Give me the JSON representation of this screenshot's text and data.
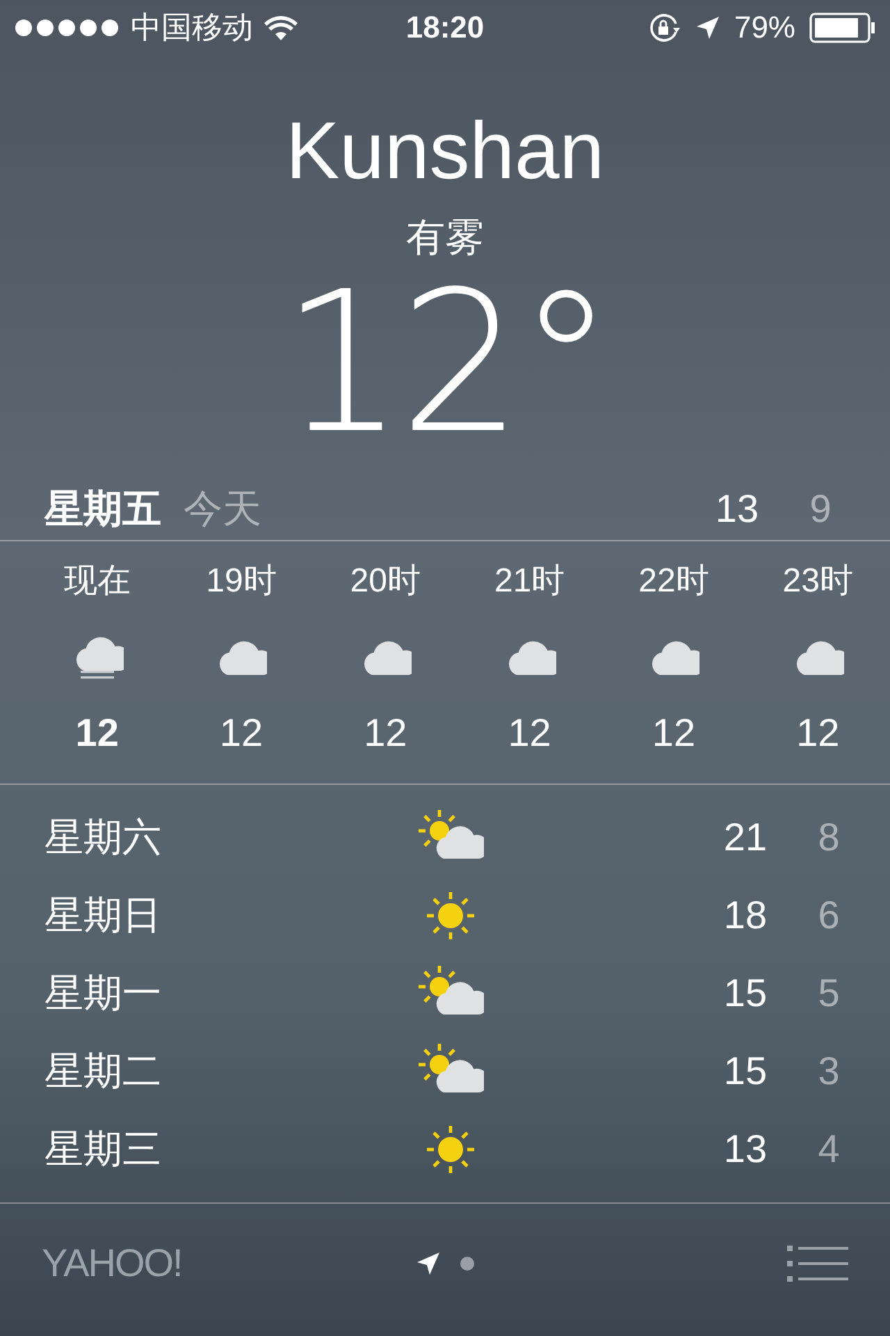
{
  "status_bar": {
    "carrier": "中国移动",
    "time": "18:20",
    "battery": "79%"
  },
  "city": "Kunshan",
  "condition": "有雾",
  "temperature": "12°",
  "today": {
    "day": "星期五",
    "label": "今天",
    "high": "13",
    "low": "9"
  },
  "hourly": [
    {
      "time": "现在",
      "kind": "fog",
      "temp": "12"
    },
    {
      "time": "19时",
      "kind": "cloudy",
      "temp": "12"
    },
    {
      "time": "20时",
      "kind": "cloudy",
      "temp": "12"
    },
    {
      "time": "21时",
      "kind": "cloudy",
      "temp": "12"
    },
    {
      "time": "22时",
      "kind": "cloudy",
      "temp": "12"
    },
    {
      "time": "23时",
      "kind": "cloudy",
      "temp": "12"
    }
  ],
  "daily": [
    {
      "day": "星期六",
      "kind": "partly_sunny",
      "high": "21",
      "low": "8"
    },
    {
      "day": "星期日",
      "kind": "sunny",
      "high": "18",
      "low": "6"
    },
    {
      "day": "星期一",
      "kind": "partly_sunny",
      "high": "15",
      "low": "5"
    },
    {
      "day": "星期二",
      "kind": "partly_sunny",
      "high": "15",
      "low": "3"
    },
    {
      "day": "星期三",
      "kind": "sunny",
      "high": "13",
      "low": "4"
    }
  ],
  "footer": {
    "logo": "YAHOO!",
    "pages": [
      {
        "kind": "location",
        "selected": true
      },
      {
        "kind": "dot",
        "selected": false
      }
    ]
  }
}
